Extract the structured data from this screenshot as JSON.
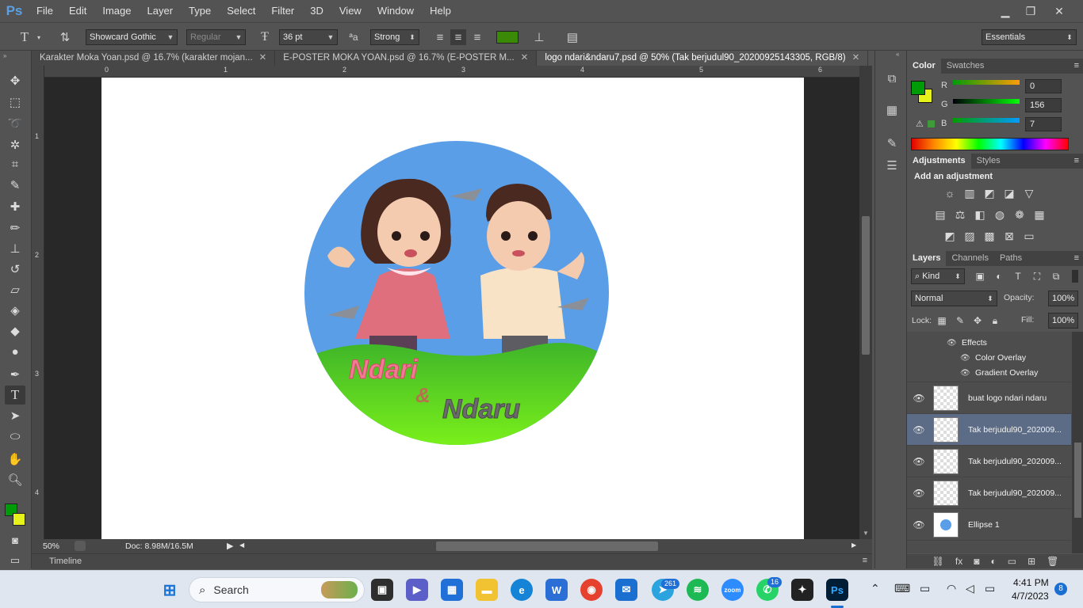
{
  "app": {
    "logo": "Ps"
  },
  "menu": [
    "File",
    "Edit",
    "Image",
    "Layer",
    "Type",
    "Select",
    "Filter",
    "3D",
    "View",
    "Window",
    "Help"
  ],
  "window_controls": {
    "minimize": "▁",
    "restore": "❐",
    "close": "✕"
  },
  "options": {
    "tool_glyph": "T",
    "font_family": "Showcard Gothic",
    "font_style": "Regular",
    "font_size": "36 pt",
    "antialias": "Strong",
    "text_color": "#3a8a08",
    "workspace": "Essentials"
  },
  "tabs": [
    {
      "label": "Karakter Moka Yoan.psd @ 16.7% (karakter mojan...",
      "close": "✕",
      "active": false
    },
    {
      "label": "E-POSTER MOKA YOAN.psd @ 16.7% (E-POSTER M...",
      "close": "✕",
      "active": false
    },
    {
      "label": "logo ndari&ndaru7.psd @ 50% (Tak berjudul90_20200925143305, RGB/8)",
      "close": "✕",
      "active": true
    }
  ],
  "ruler": {
    "top": [
      "0",
      "1",
      "2",
      "3",
      "4",
      "5",
      "6"
    ],
    "left": [
      "1",
      "2",
      "3",
      "4"
    ]
  },
  "artwork": {
    "text1": "Ndari",
    "ampersand": "&",
    "text2": "Ndaru",
    "circle_color": "#5b9ee8",
    "grass_color": "#55cc22"
  },
  "status": {
    "zoom": "50%",
    "doc": "Doc: 8.98M/16.5M",
    "timeline": "Timeline"
  },
  "color_panel": {
    "tabs": [
      "Color",
      "Swatches"
    ],
    "labels": {
      "r": "R",
      "g": "G",
      "b": "B"
    },
    "r": "0",
    "g": "156",
    "b": "7",
    "foreground": "#009c07",
    "background": "#e6f21a"
  },
  "adjustments": {
    "tabs": [
      "Adjustments",
      "Styles"
    ],
    "heading": "Add an adjustment"
  },
  "layers": {
    "tabs": [
      "Layers",
      "Channels",
      "Paths"
    ],
    "filter": "Kind",
    "blend_mode": "Normal",
    "opacity_label": "Opacity:",
    "opacity": "100%",
    "lock_label": "Lock:",
    "fill_label": "Fill:",
    "fill": "100%",
    "effects": {
      "title": "Effects",
      "items": [
        "Color Overlay",
        "Gradient Overlay"
      ]
    },
    "rows": [
      {
        "name": "buat logo ndari ndaru",
        "selected": false
      },
      {
        "name": "Tak berjudul90_202009...",
        "selected": true
      },
      {
        "name": "Tak berjudul90_202009...",
        "selected": false
      },
      {
        "name": "Tak berjudul90_202009...",
        "selected": false
      },
      {
        "name": "Ellipse 1",
        "selected": false
      }
    ]
  },
  "taskbar": {
    "search": "Search",
    "badges": {
      "telegram": "261",
      "whatsapp": "16"
    },
    "time": "4:41 PM",
    "date": "4/7/2023",
    "notifications": "8"
  }
}
